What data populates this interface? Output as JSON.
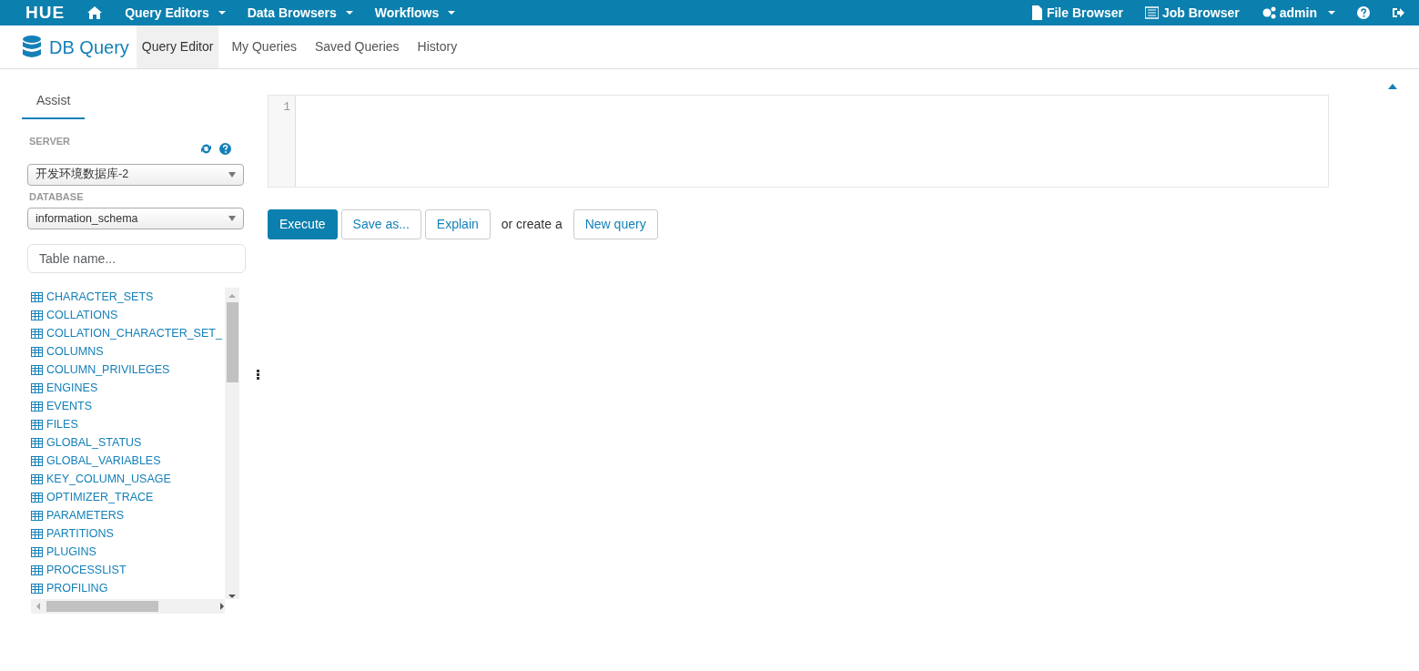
{
  "top_nav": {
    "logo": "HUE",
    "menus": [
      {
        "label": "Query Editors",
        "dropdown": true
      },
      {
        "label": "Data Browsers",
        "dropdown": true
      },
      {
        "label": "Workflows",
        "dropdown": true
      }
    ],
    "right": [
      {
        "kind": "file",
        "label": "File Browser",
        "dropdown": false
      },
      {
        "kind": "job",
        "label": "Job Browser",
        "dropdown": false
      },
      {
        "kind": "user",
        "label": "admin",
        "dropdown": true
      }
    ]
  },
  "app_bar": {
    "title": "DB Query",
    "tabs": [
      {
        "label": "Query Editor",
        "selected": true
      },
      {
        "label": "My Queries",
        "selected": false
      },
      {
        "label": "Saved Queries",
        "selected": false
      },
      {
        "label": "History",
        "selected": false
      }
    ]
  },
  "assist": {
    "tab": "Assist",
    "server_label": "SERVER",
    "server": "开发环境数据库-2",
    "database_label": "DATABASE",
    "database": "information_schema",
    "search": {
      "placeholder": "Table name..."
    },
    "tables": [
      "CHARACTER_SETS",
      "COLLATIONS",
      "COLLATION_CHARACTER_SET_",
      "COLUMNS",
      "COLUMN_PRIVILEGES",
      "ENGINES",
      "EVENTS",
      "FILES",
      "GLOBAL_STATUS",
      "GLOBAL_VARIABLES",
      "KEY_COLUMN_USAGE",
      "OPTIMIZER_TRACE",
      "PARAMETERS",
      "PARTITIONS",
      "PLUGINS",
      "PROCESSLIST",
      "PROFILING"
    ]
  },
  "editor": {
    "line_numbers": [
      "1"
    ]
  },
  "actions": [
    {
      "kind": "primary",
      "label": "Execute"
    },
    {
      "kind": "default",
      "label": "Save as..."
    },
    {
      "kind": "default",
      "label": "Explain"
    },
    {
      "kind": "text",
      "label": "or create a"
    },
    {
      "kind": "default",
      "label": "New query"
    }
  ]
}
